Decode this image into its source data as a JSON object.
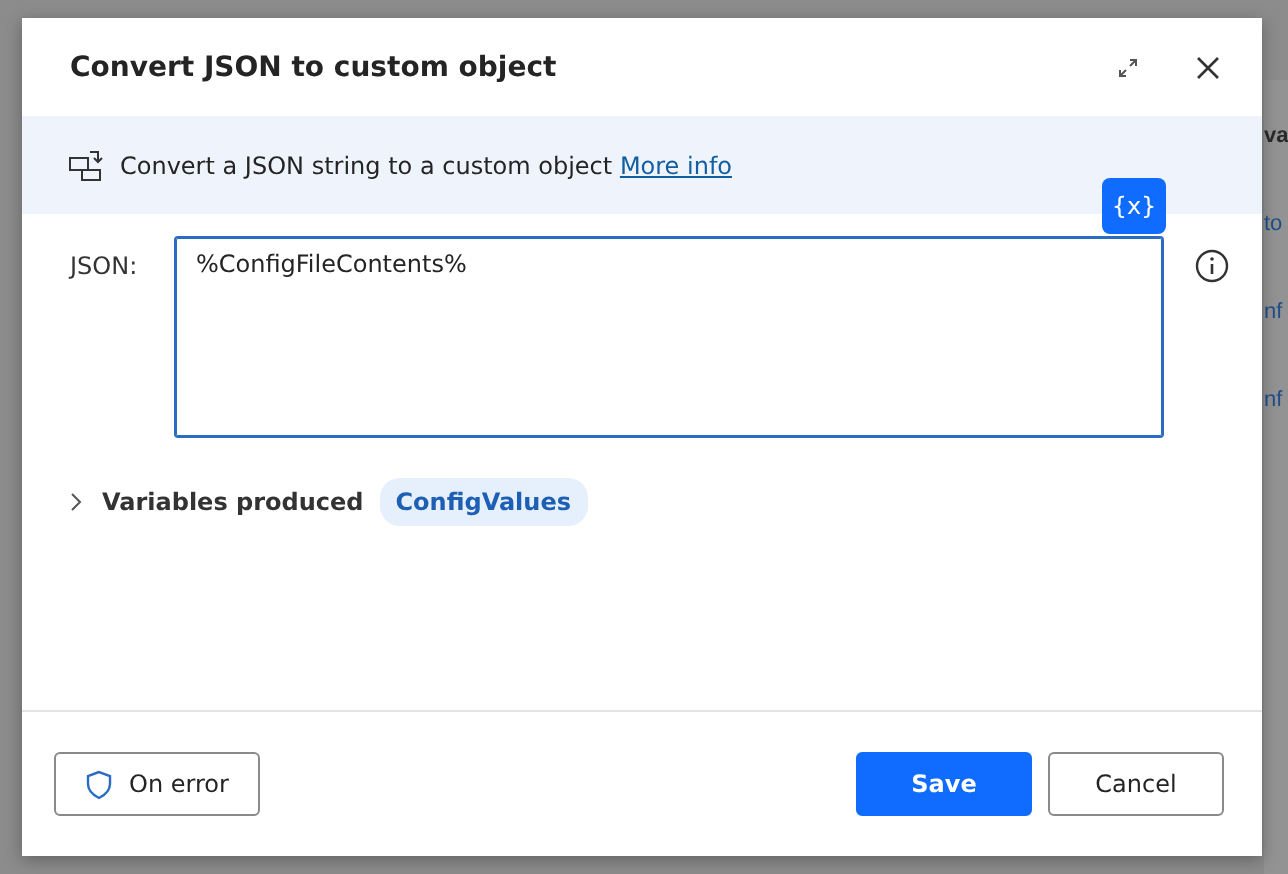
{
  "background": {
    "side_texts": [
      {
        "text": "va",
        "kind": "heading"
      },
      {
        "text": "to",
        "kind": "link"
      },
      {
        "text": "nf",
        "kind": "link"
      },
      {
        "text": "nf",
        "kind": "link"
      }
    ]
  },
  "dialog": {
    "title": "Convert JSON to custom object",
    "description": "Convert a JSON string to a custom object",
    "more_info": "More info",
    "variable_button": "{x}",
    "fields": [
      {
        "label": "JSON:",
        "value": "%ConfigFileContents%",
        "focused": true
      }
    ],
    "variables_produced": {
      "label": "Variables produced",
      "expanded": false,
      "variables": [
        "ConfigValues"
      ]
    },
    "buttons": [
      {
        "label": "On error",
        "kind": "secondary-icon"
      },
      {
        "label": "Save",
        "kind": "primary"
      },
      {
        "label": "Cancel",
        "kind": "secondary"
      }
    ]
  }
}
